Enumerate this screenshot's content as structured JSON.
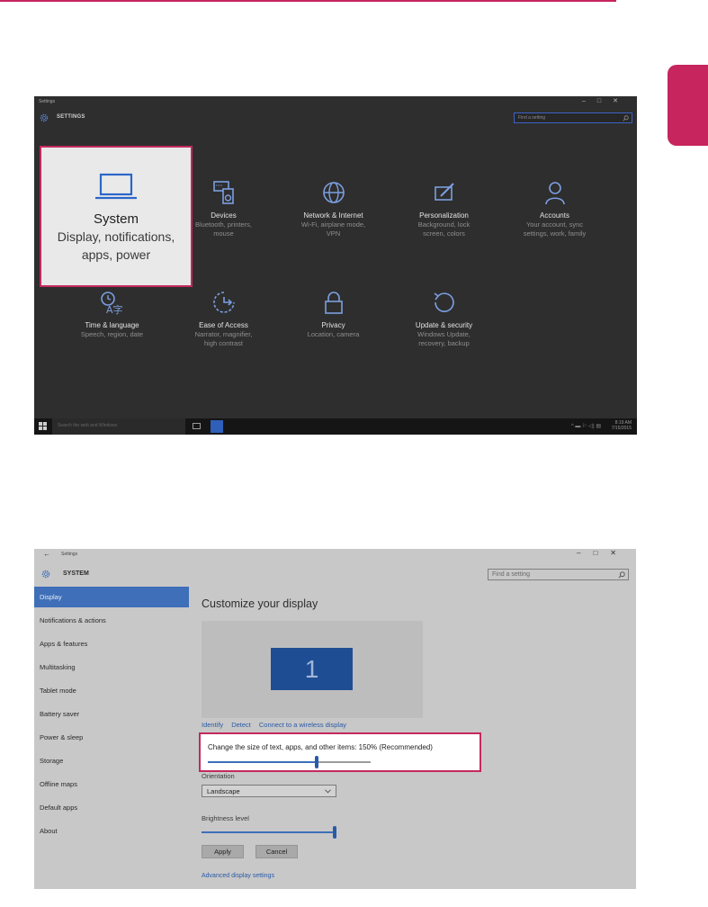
{
  "settings_home": {
    "window_title": "Settings",
    "window_controls": [
      "–",
      "□",
      "✕"
    ],
    "header": "SETTINGS",
    "search_placeholder": "Find a setting",
    "tiles": [
      {
        "name": "System",
        "desc": [
          "Display, notifications,",
          "apps, power"
        ],
        "icon": "laptop-icon"
      },
      {
        "name": "Devices",
        "desc": [
          "Bluetooth, printers,",
          "mouse"
        ],
        "icon": "keyboard-speaker-icon"
      },
      {
        "name": "Network & Internet",
        "desc": [
          "Wi-Fi, airplane mode,",
          "VPN"
        ],
        "icon": "globe-icon"
      },
      {
        "name": "Personalization",
        "desc": [
          "Background, lock",
          "screen, colors"
        ],
        "icon": "paintbrush-screen-icon"
      },
      {
        "name": "Accounts",
        "desc": [
          "Your account, sync",
          "settings, work, family"
        ],
        "icon": "person-icon"
      },
      {
        "name": "Time & language",
        "desc": [
          "Speech, region, date"
        ],
        "icon": "clock-language-icon"
      },
      {
        "name": "Ease of Access",
        "desc": [
          "Narrator, magnifier,",
          "high contrast"
        ],
        "icon": "ease-of-access-icon"
      },
      {
        "name": "Privacy",
        "desc": [
          "Location, camera"
        ],
        "icon": "lock-icon"
      },
      {
        "name": "Update & security",
        "desc": [
          "Windows Update,",
          "recovery, backup"
        ],
        "icon": "refresh-icon"
      }
    ],
    "taskbar": {
      "search_placeholder": "Search the web and Windows",
      "tray": "^ ▬ ⚐ ◁) ▤",
      "clock_time": "8:19 AM",
      "clock_date": "7/15/2015"
    }
  },
  "display_settings": {
    "window_title": "Settings",
    "back_glyph": "←",
    "window_controls": [
      "–",
      "□",
      "✕"
    ],
    "header": "SYSTEM",
    "search_placeholder": "Find a setting",
    "nav_items": [
      "Display",
      "Notifications & actions",
      "Apps & features",
      "Multitasking",
      "Tablet mode",
      "Battery saver",
      "Power & sleep",
      "Storage",
      "Offline maps",
      "Default apps",
      "About"
    ],
    "selected_nav": "Display",
    "page_title": "Customize your display",
    "monitor_number": "1",
    "links": [
      "Identify",
      "Detect",
      "Connect to a wireless display"
    ],
    "scale_label": "Change the size of text, apps, and other items: 150% (Recommended)",
    "scale_level": 0.67,
    "orientation_label": "Orientation",
    "orientation_value": "Landscape",
    "brightness_label": "Brightness level",
    "brightness_level": 1.0,
    "apply_label": "Apply",
    "cancel_label": "Cancel",
    "advanced_link": "Advanced display settings"
  },
  "colors": {
    "highlight_border": "#c4295d",
    "accent_blue": "#3e6fb8",
    "monitor_blue": "#1f4d93",
    "link_blue": "#2a5aa8"
  }
}
